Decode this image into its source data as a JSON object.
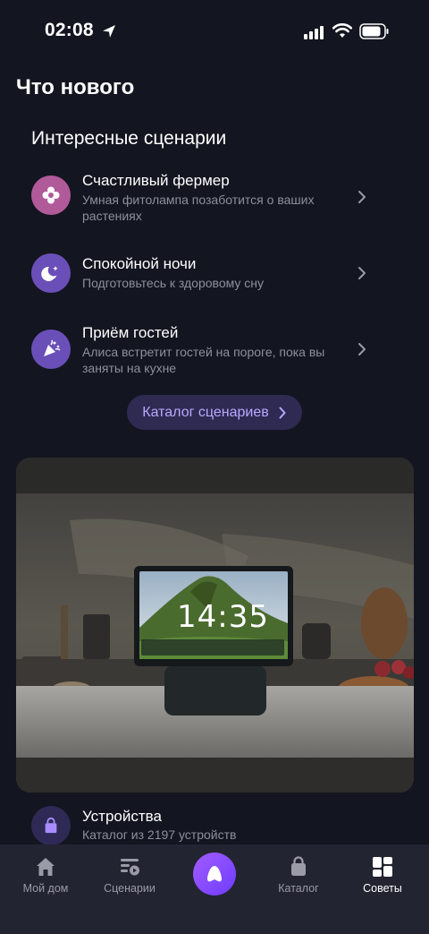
{
  "status_bar": {
    "time": "02:08"
  },
  "page_title": "Что нового",
  "section_title": "Интересные сценарии",
  "scenarios": [
    {
      "title": "Счастливый фермер",
      "description": "Умная фитолампа позаботится о ваших растениях",
      "icon": "flower-icon",
      "color": "#b05a9a"
    },
    {
      "title": "Спокойной ночи",
      "description": "Подготовьтесь к здоровому сну",
      "icon": "moon-icon",
      "color": "#6b4fb8"
    },
    {
      "title": "Приём гостей",
      "description": "Алиса встретит гостей на пороге, пока вы заняты на кухне",
      "icon": "party-icon",
      "color": "#6b4fb8"
    }
  ],
  "catalog_button": {
    "label": "Каталог сценариев"
  },
  "promo": {
    "clock": "14:35"
  },
  "devices": {
    "title": "Устройства",
    "description": "Каталог из 2197 устройств",
    "icon": "bag-icon"
  },
  "tabs": [
    {
      "label": "Мой дом",
      "icon": "home-icon"
    },
    {
      "label": "Сценарии",
      "icon": "scenarios-icon"
    },
    {
      "label": "",
      "icon": "alice-icon"
    },
    {
      "label": "Каталог",
      "icon": "bag-icon"
    },
    {
      "label": "Советы",
      "icon": "tips-icon",
      "active": true
    }
  ],
  "colors": {
    "background": "#131520",
    "accent": "#b9a8ff",
    "tab_bar": "#222431"
  }
}
